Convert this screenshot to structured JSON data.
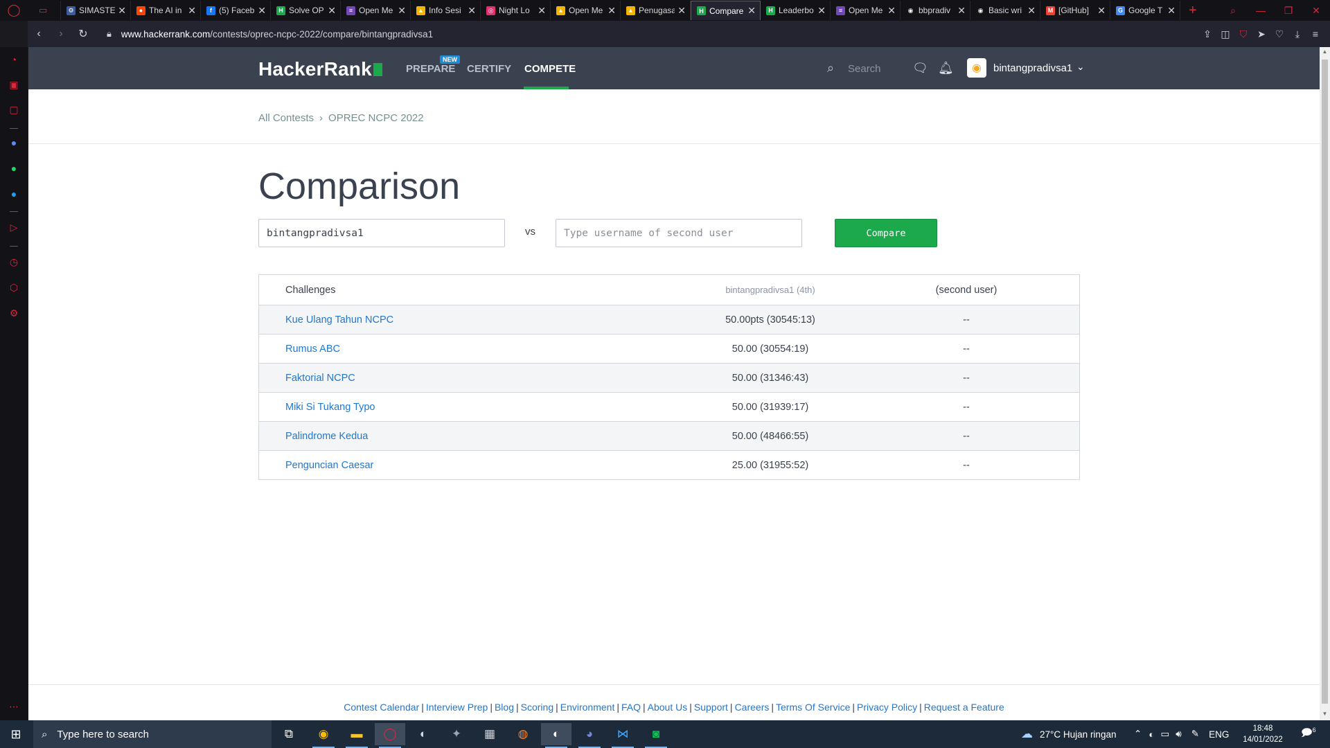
{
  "browser": {
    "tabs": [
      {
        "title": "SIMASTE",
        "favicon_color": "#3b5b9c",
        "glyph": "⚙"
      },
      {
        "title": "The AI in",
        "favicon_color": "#ff4500",
        "glyph": "●"
      },
      {
        "title": "(5) Faceb",
        "favicon_color": "#1877f2",
        "glyph": "f"
      },
      {
        "title": "Solve OP",
        "favicon_color": "#1ba94c",
        "glyph": "H"
      },
      {
        "title": "Open Me",
        "favicon_color": "#7248b9",
        "glyph": "≡"
      },
      {
        "title": "Info Sesi",
        "favicon_color": "#f4b400",
        "glyph": "▲"
      },
      {
        "title": "Night Lo",
        "favicon_color": "#e1306c",
        "glyph": "◎"
      },
      {
        "title": "Open Me",
        "favicon_color": "#f4b400",
        "glyph": "▲"
      },
      {
        "title": "Penugasa",
        "favicon_color": "#f4b400",
        "glyph": "▲"
      },
      {
        "title": "Compare",
        "favicon_color": "#1ba94c",
        "glyph": "H",
        "active": true
      },
      {
        "title": "Leaderbo",
        "favicon_color": "#1ba94c",
        "glyph": "H"
      },
      {
        "title": "Open Me",
        "favicon_color": "#7248b9",
        "glyph": "≡"
      },
      {
        "title": "bbpradiv",
        "favicon_color": "#ffffff",
        "glyph": "◉"
      },
      {
        "title": "Basic wri",
        "favicon_color": "#ffffff",
        "glyph": "◉"
      },
      {
        "title": "[GitHub]",
        "favicon_color": "#ea4335",
        "glyph": "M"
      },
      {
        "title": "Google T",
        "favicon_color": "#4285f4",
        "glyph": "G"
      }
    ],
    "url_domain": "www.hackerrank.com",
    "url_path": "/contests/oprec-ncpc-2022/compare/bintangpradivsa1"
  },
  "header": {
    "logo": "HackerRank",
    "nav": {
      "prepare": "PREPARE",
      "new_badge": "NEW",
      "certify": "CERTIFY",
      "compete": "COMPETE"
    },
    "search_placeholder": "Search",
    "username": "bintangpradivsa1"
  },
  "breadcrumb": {
    "all_contests": "All Contests",
    "contest": "OPREC NCPC 2022"
  },
  "page": {
    "title": "Comparison",
    "first_user_value": "bintangpradivsa1",
    "vs": "vs",
    "second_user_placeholder": "Type username of second user",
    "compare_button": "Compare"
  },
  "table": {
    "headers": {
      "challenges": "Challenges",
      "user1": "bintangpradivsa1 (4th)",
      "user2": "(second user)"
    },
    "rows": [
      {
        "challenge": "Kue Ulang Tahun NCPC",
        "user1": "50.00pts (30545:13)",
        "user2": "--"
      },
      {
        "challenge": "Rumus ABC",
        "user1": "50.00 (30554:19)",
        "user2": "--"
      },
      {
        "challenge": "Faktorial NCPC",
        "user1": "50.00 (31346:43)",
        "user2": "--"
      },
      {
        "challenge": "Miki Si Tukang Typo",
        "user1": "50.00 (31939:17)",
        "user2": "--"
      },
      {
        "challenge": "Palindrome Kedua",
        "user1": "50.00 (48466:55)",
        "user2": "--"
      },
      {
        "challenge": "Penguncian Caesar",
        "user1": "25.00 (31955:52)",
        "user2": "--"
      }
    ]
  },
  "footer": {
    "links": [
      "Contest Calendar",
      "Interview Prep",
      "Blog",
      "Scoring",
      "Environment",
      "FAQ",
      "About Us",
      "Support",
      "Careers",
      "Terms Of Service",
      "Privacy Policy",
      "Request a Feature"
    ]
  },
  "taskbar": {
    "search_placeholder": "Type here to search",
    "weather": "27°C  Hujan ringan",
    "language": "ENG",
    "time": "18:48",
    "date": "14/01/2022",
    "notification_count": "6"
  },
  "colors": {
    "accent_green": "#1ba94c",
    "link_blue": "#2277cf",
    "header_bg": "#39424e",
    "opera_red": "#d8283d"
  }
}
